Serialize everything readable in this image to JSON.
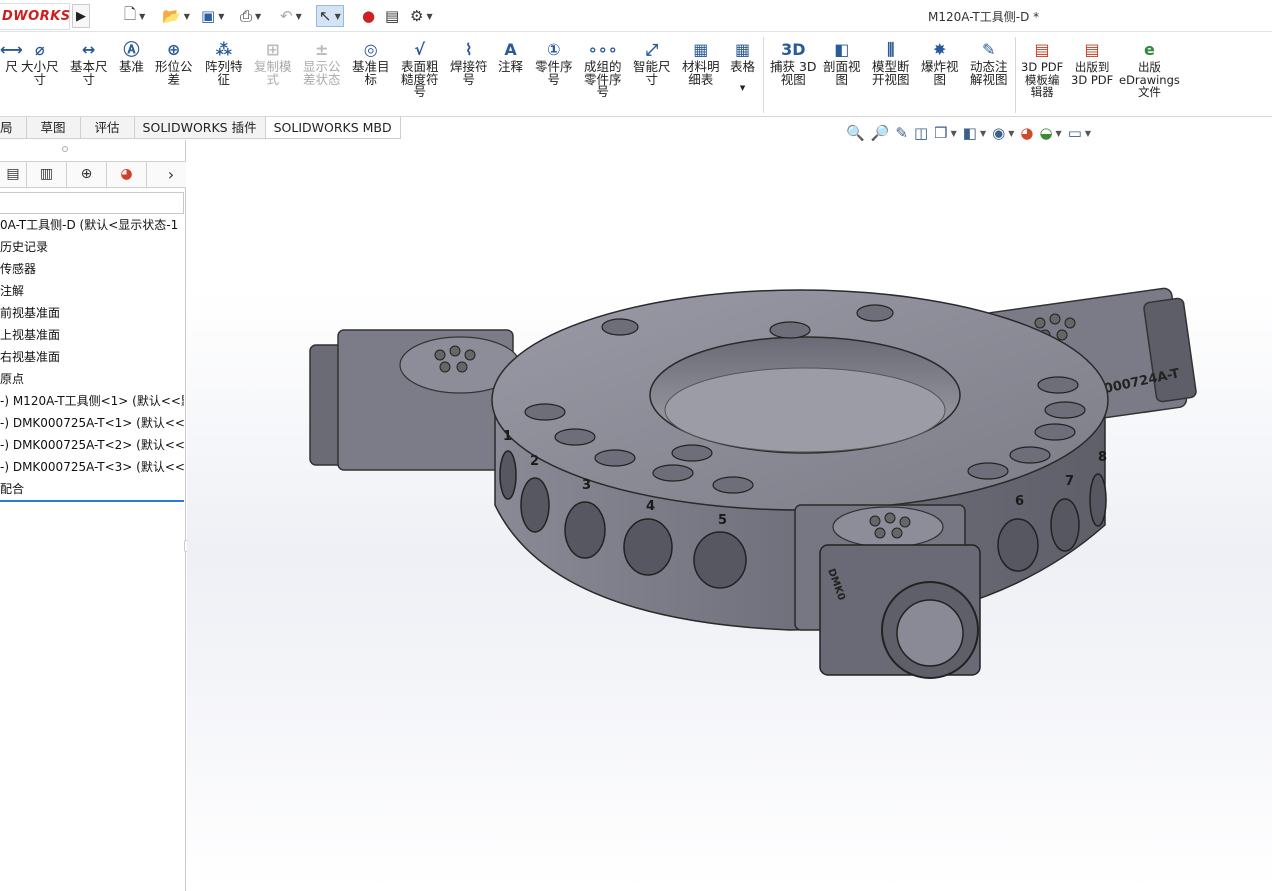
{
  "app": {
    "logo_prefix": "D",
    "logo_suffix": "WORKS",
    "window_title": "M120A-T工具侧-D *"
  },
  "quick_access": [
    {
      "icon": "new-document-icon"
    },
    {
      "icon": "open-folder-icon"
    },
    {
      "icon": "save-icon"
    },
    {
      "icon": "print-icon"
    },
    {
      "icon": "undo-icon"
    },
    {
      "icon": "select-pointer-icon"
    },
    {
      "icon": "rebuild-traffic-light-icon"
    },
    {
      "icon": "file-properties-icon"
    },
    {
      "icon": "options-gear-icon"
    }
  ],
  "command_manager": {
    "items": [
      {
        "label": "尺",
        "icon": "dimension-icon",
        "enabled": true
      },
      {
        "label": "大小尺\n寸",
        "icon": "size-dimension-icon",
        "enabled": true
      },
      {
        "label": "基本尺\n寸",
        "icon": "basic-dimension-icon",
        "enabled": true
      },
      {
        "label": "基准",
        "icon": "datum-icon",
        "enabled": true
      },
      {
        "label": "形位公\n差",
        "icon": "geometric-tolerance-icon",
        "enabled": true
      },
      {
        "label": "阵列特\n征",
        "icon": "pattern-feature-icon",
        "enabled": true
      },
      {
        "label": "复制模\n式",
        "icon": "copy-scheme-icon",
        "enabled": false
      },
      {
        "label": "显示公\n差状态",
        "icon": "tolerance-status-icon",
        "enabled": false
      },
      {
        "label": "基准目\n标",
        "icon": "datum-target-icon",
        "enabled": true
      },
      {
        "label": "表面粗\n糙度符\n号",
        "icon": "surface-finish-icon",
        "enabled": true
      },
      {
        "label": "焊接符\n号",
        "icon": "weld-symbol-icon",
        "enabled": true
      },
      {
        "label": "注释",
        "icon": "note-icon",
        "enabled": true
      },
      {
        "label": "零件序\n号",
        "icon": "balloon-icon",
        "enabled": true
      },
      {
        "label": "成组的\n零件序\n号",
        "icon": "stacked-balloon-icon",
        "enabled": true
      },
      {
        "label": "智能尺\n寸",
        "icon": "smart-dimension-icon",
        "enabled": true
      },
      {
        "label": "材料明\n细表",
        "icon": "bill-of-materials-icon",
        "enabled": true
      },
      {
        "label": "表格",
        "icon": "table-icon",
        "enabled": true
      },
      {
        "label": "捕获 3D\n视图",
        "icon": "capture-3d-view-icon",
        "enabled": true
      },
      {
        "label": "剖面视\n图",
        "icon": "section-view-icon",
        "enabled": true
      },
      {
        "label": "模型断\n开视图",
        "icon": "model-break-view-icon",
        "enabled": true
      },
      {
        "label": "爆炸视\n图",
        "icon": "exploded-view-icon",
        "enabled": true
      },
      {
        "label": "动态注\n解视图",
        "icon": "dynamic-annotation-view-icon",
        "enabled": true
      },
      {
        "label": "3D PDF\n模板编\n辑器",
        "icon": "3d-pdf-template-icon",
        "enabled": true
      },
      {
        "label": "出版到\n3D PDF",
        "icon": "publish-3d-pdf-icon",
        "enabled": true
      },
      {
        "label": "出版\neDrawings\n文件",
        "icon": "edrawings-icon",
        "enabled": true
      }
    ]
  },
  "tabs": [
    "局",
    "草图",
    "评估",
    "SOLIDWORKS 插件",
    "SOLIDWORKS MBD"
  ],
  "active_tab": "SOLIDWORKS MBD",
  "panel_tabs": [
    {
      "icon": "feature-manager-icon"
    },
    {
      "icon": "property-manager-icon"
    },
    {
      "icon": "configuration-manager-icon"
    },
    {
      "icon": "display-manager-icon"
    },
    {
      "icon": "more-chevron-icon"
    }
  ],
  "feature_tree": [
    "0A-T工具侧-D  (默认<显示状态-1",
    "历史记录",
    "传感器",
    "注解",
    "前视基准面",
    "上视基准面",
    "右视基准面",
    "原点",
    "-) M120A-T工具侧<1> (默认<<默",
    "-) DMK000725A-T<1> (默认<<默",
    "-) DMK000725A-T<2> (默认<<默",
    "-) DMK000725A-T<3> (默认<<默",
    "配合"
  ],
  "heads_up_toolbar": [
    "zoom-to-fit-icon",
    "zoom-to-area-icon",
    "previous-view-icon",
    "section-view-icon",
    "view-orientation-icon",
    "display-style-icon",
    "hide-show-items-icon",
    "edit-appearance-icon",
    "apply-scene-icon",
    "view-settings-icon"
  ],
  "model": {
    "port_numbers": [
      "1",
      "2",
      "3",
      "4",
      "5",
      "6",
      "7",
      "8"
    ],
    "connector_label": "000724A-T",
    "connector_label_side": "DMK0"
  }
}
